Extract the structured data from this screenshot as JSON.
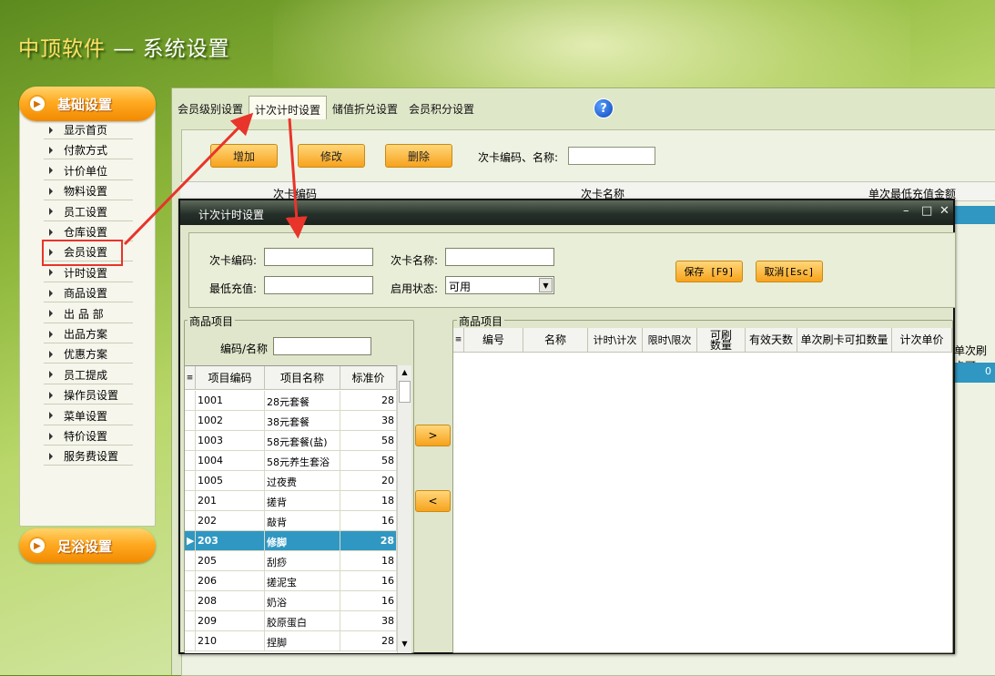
{
  "app": {
    "brand": "中顶软件",
    "separator": " — ",
    "title": "系统设置"
  },
  "sidebar": {
    "section_basic": "基础设置",
    "section_foot": "足浴设置",
    "items": [
      {
        "label": "显示首页"
      },
      {
        "label": "付款方式"
      },
      {
        "label": "计价单位"
      },
      {
        "label": "物料设置"
      },
      {
        "label": "员工设置"
      },
      {
        "label": "仓库设置"
      },
      {
        "label": "会员设置"
      },
      {
        "label": "计时设置"
      },
      {
        "label": "商品设置"
      },
      {
        "label": "出 品 部"
      },
      {
        "label": "出品方案"
      },
      {
        "label": "优惠方案"
      },
      {
        "label": "员工提成"
      },
      {
        "label": "操作员设置"
      },
      {
        "label": "菜单设置"
      },
      {
        "label": "特价设置"
      },
      {
        "label": "服务费设置"
      }
    ]
  },
  "tabs": [
    "会员级别设置",
    "计次计时设置",
    "储值折兑设置",
    "会员积分设置"
  ],
  "background_panel": {
    "add": "增加",
    "edit": "修改",
    "delete": "删除",
    "search_label": "次卡编码、名称:",
    "col_code": "次卡编码",
    "col_name": "次卡名称",
    "col_min": "单次最低充值金额",
    "col_extra": "单次刷卡可",
    "extra_value": "0"
  },
  "dialog": {
    "title": "计次计时设置",
    "card_code_label": "次卡编码:",
    "card_name_label": "次卡名称:",
    "min_recharge_label": "最低充值:",
    "status_label": "启用状态:",
    "status_value": "可用",
    "save": "保存 [F9]",
    "cancel": "取消[Esc]",
    "left_group": "商品项目",
    "right_group": "商品项目",
    "code_name_label": "编码/名称",
    "left_columns": [
      "项目编码",
      "项目名称",
      "标准价"
    ],
    "right_columns": [
      "编号",
      "名称",
      "计时\\计次",
      "限时\\限次",
      "可刷数量",
      "有效天数",
      "单次刷卡可扣数量",
      "计次单价"
    ],
    "move_right": ">",
    "move_left": "<",
    "products": [
      {
        "code": "1001",
        "name": "28元套餐",
        "price": "28"
      },
      {
        "code": "1002",
        "name": "38元套餐",
        "price": "38"
      },
      {
        "code": "1003",
        "name": "58元套餐(盐)",
        "price": "58"
      },
      {
        "code": "1004",
        "name": "58元养生套浴",
        "price": "58"
      },
      {
        "code": "1005",
        "name": "过夜费",
        "price": "20"
      },
      {
        "code": "201",
        "name": "搓背",
        "price": "18"
      },
      {
        "code": "202",
        "name": "敲背",
        "price": "16"
      },
      {
        "code": "203",
        "name": "修脚",
        "price": "28"
      },
      {
        "code": "205",
        "name": "刮痧",
        "price": "18"
      },
      {
        "code": "206",
        "name": "搓泥宝",
        "price": "16"
      },
      {
        "code": "208",
        "name": "奶浴",
        "price": "16"
      },
      {
        "code": "209",
        "name": "胶原蛋白",
        "price": "38"
      },
      {
        "code": "210",
        "name": "捏脚",
        "price": "28"
      }
    ],
    "selected_index": 7
  },
  "colors": {
    "accent_orange": "#f7a21c",
    "selection_blue": "#2f97c2",
    "highlight_red": "#e8342a"
  }
}
